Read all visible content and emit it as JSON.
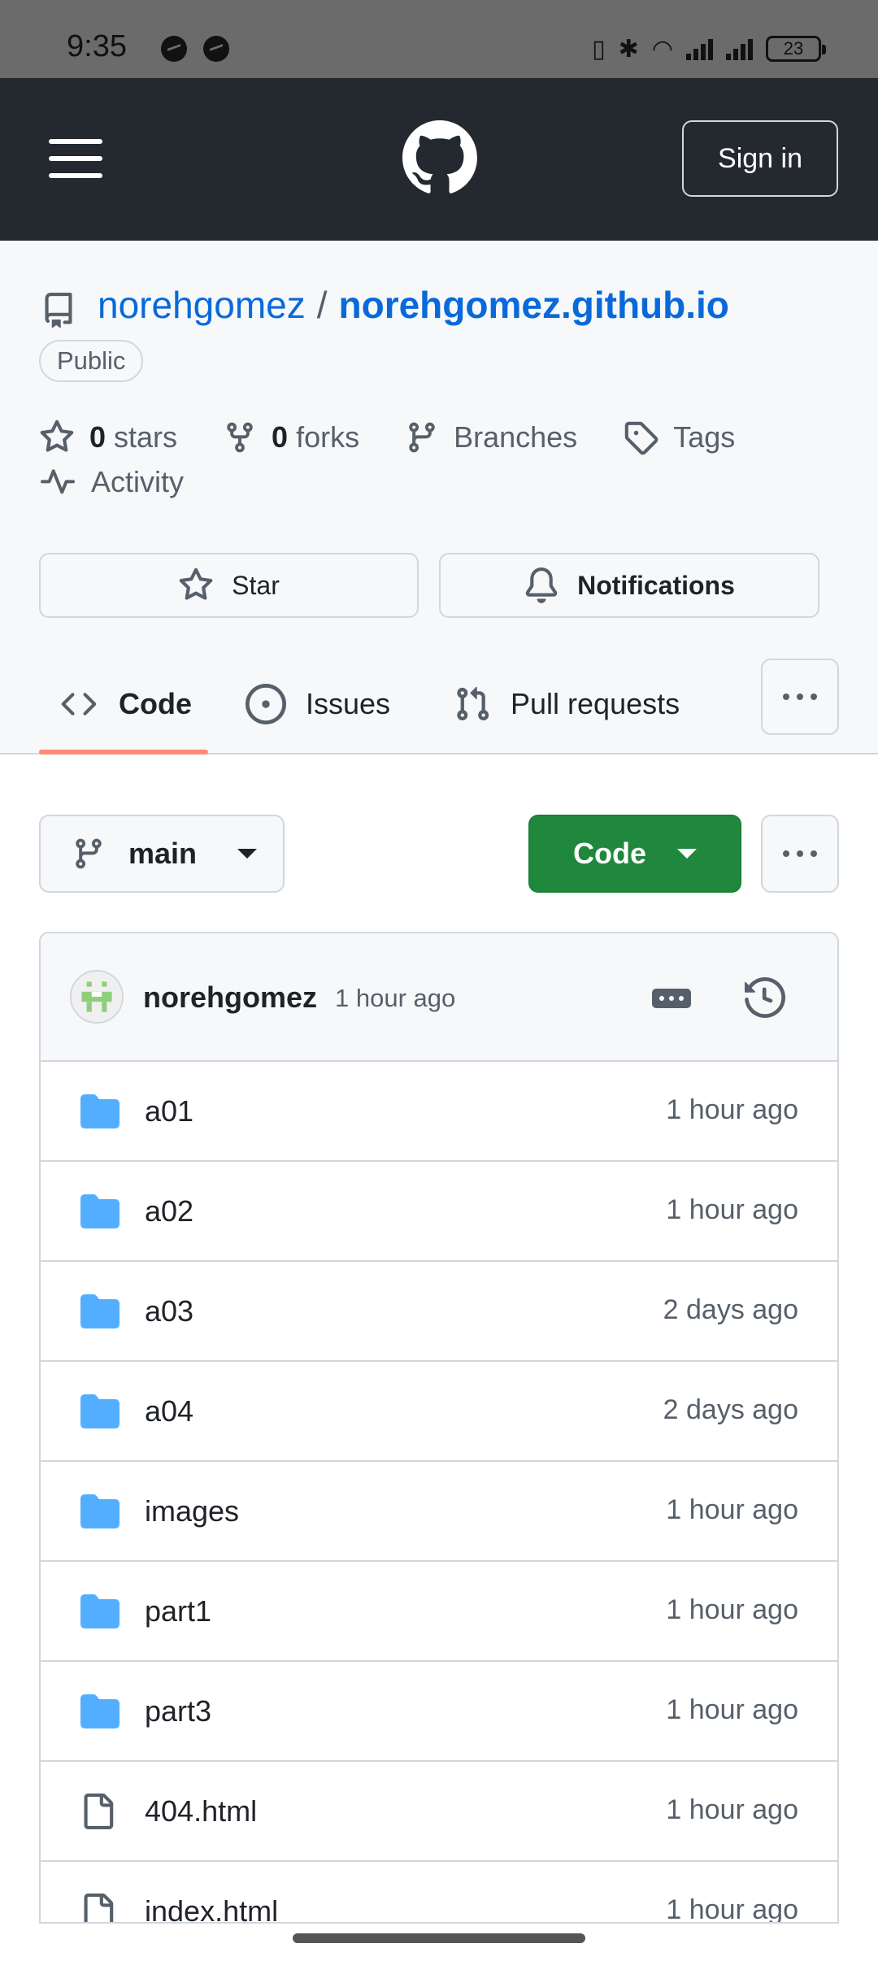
{
  "status_bar": {
    "time": "9:35",
    "battery": "23"
  },
  "header": {
    "sign_in_label": "Sign in"
  },
  "repo": {
    "owner": "norehgomez",
    "separator": "/",
    "name": "norehgomez.github.io",
    "visibility": "Public",
    "stars_count": "0",
    "stars_label": "stars",
    "forks_count": "0",
    "forks_label": "forks",
    "branches_label": "Branches",
    "tags_label": "Tags",
    "activity_label": "Activity",
    "star_button": "Star",
    "notifications_button": "Notifications"
  },
  "tabs": [
    {
      "label": "Code",
      "active": true
    },
    {
      "label": "Issues",
      "active": false
    },
    {
      "label": "Pull requests",
      "active": false
    }
  ],
  "toolbar": {
    "branch": "main",
    "code_button": "Code"
  },
  "commit": {
    "author": "norehgomez",
    "time": "1 hour ago"
  },
  "files": [
    {
      "name": "a01",
      "type": "folder",
      "time": "1 hour ago"
    },
    {
      "name": "a02",
      "type": "folder",
      "time": "1 hour ago"
    },
    {
      "name": "a03",
      "type": "folder",
      "time": "2 days ago"
    },
    {
      "name": "a04",
      "type": "folder",
      "time": "2 days ago"
    },
    {
      "name": "images",
      "type": "folder",
      "time": "1 hour ago"
    },
    {
      "name": "part1",
      "type": "folder",
      "time": "1 hour ago"
    },
    {
      "name": "part3",
      "type": "folder",
      "time": "1 hour ago"
    },
    {
      "name": "404.html",
      "type": "file",
      "time": "1 hour ago"
    },
    {
      "name": "index.html",
      "type": "file",
      "time": "1 hour ago"
    }
  ],
  "colors": {
    "header_bg": "#24292f",
    "link_blue": "#0969da",
    "code_green": "#1f883d",
    "folder_blue": "#54aeff",
    "tab_underline": "#fd8c73"
  }
}
